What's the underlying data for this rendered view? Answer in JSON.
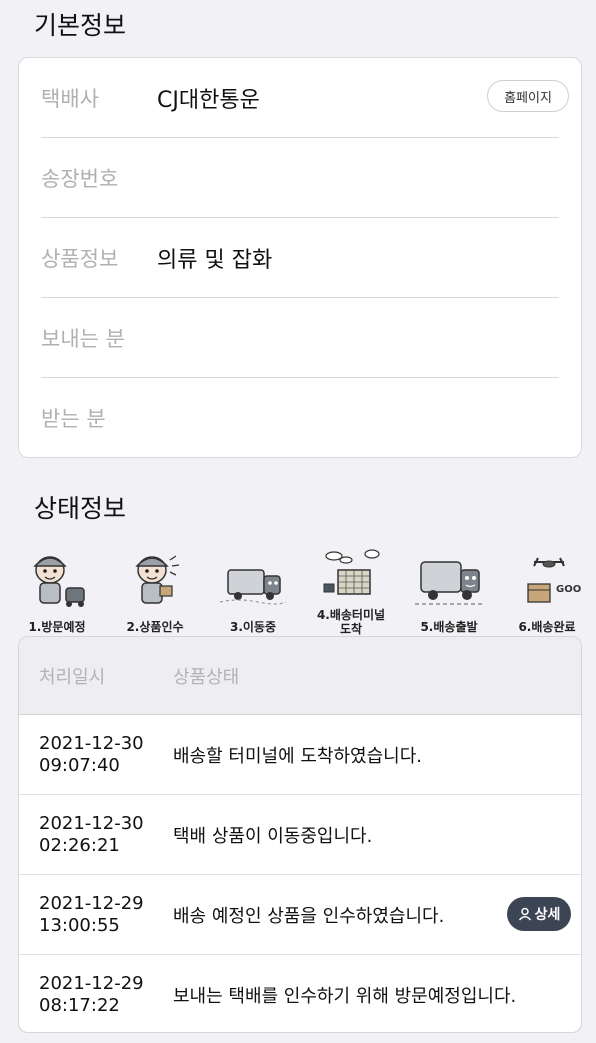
{
  "basic": {
    "title": "기본정보",
    "homepage_button": "홈페이지",
    "rows": [
      {
        "label": "택배사",
        "value": "CJ대한통운"
      },
      {
        "label": "송장번호",
        "value": ""
      },
      {
        "label": "상품정보",
        "value": "의류 및 잡화"
      },
      {
        "label": "보내는 분",
        "value": ""
      },
      {
        "label": "받는 분",
        "value": ""
      }
    ]
  },
  "status": {
    "title": "상태정보",
    "steps": [
      {
        "label": "1.방문예정",
        "icon": "courier-visit-icon"
      },
      {
        "label": "2.상품인수",
        "icon": "courier-pickup-icon"
      },
      {
        "label": "3.이동중",
        "icon": "truck-moving-icon"
      },
      {
        "label": "4.배송터미널\n도착",
        "icon": "terminal-building-icon"
      },
      {
        "label": "5.배송출발",
        "icon": "truck-departure-icon"
      },
      {
        "label": "6.배송완료",
        "icon": "delivery-complete-icon"
      }
    ],
    "table": {
      "headers": [
        "처리일시",
        "상품상태"
      ],
      "rows": [
        {
          "date": "2021-12-30",
          "time": "09:07:40",
          "status": "배송할 터미널에 도착하였습니다."
        },
        {
          "date": "2021-12-30",
          "time": "02:26:21",
          "status": "택배 상품이 이동중입니다."
        },
        {
          "date": "2021-12-29",
          "time": "13:00:55",
          "status": "배송 예정인 상품을 인수하였습니다."
        },
        {
          "date": "2021-12-29",
          "time": "08:17:22",
          "status": "보내는 택배를 인수하기 위해 방문예정입니다."
        }
      ],
      "detail_button": "상세"
    }
  },
  "colors": {
    "background": "#f2f1f6",
    "card": "#ffffff",
    "label_gray": "#b0b0b4",
    "detail_button": "#3c4554"
  }
}
